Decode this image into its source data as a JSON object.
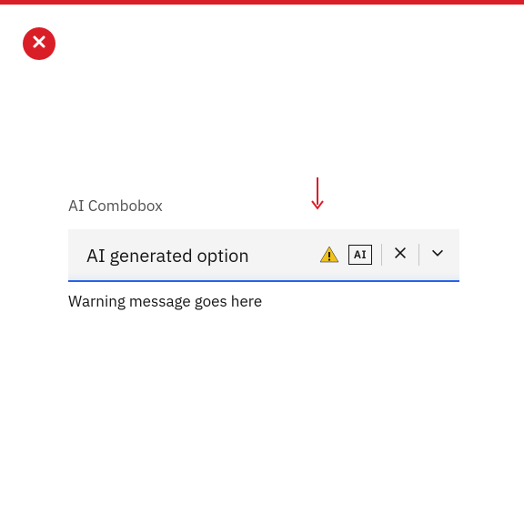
{
  "status": "error",
  "combobox": {
    "label": "AI Combobox",
    "value": "AI generated option",
    "ai_badge_text": "AI",
    "helper_text": "Warning message goes here"
  }
}
